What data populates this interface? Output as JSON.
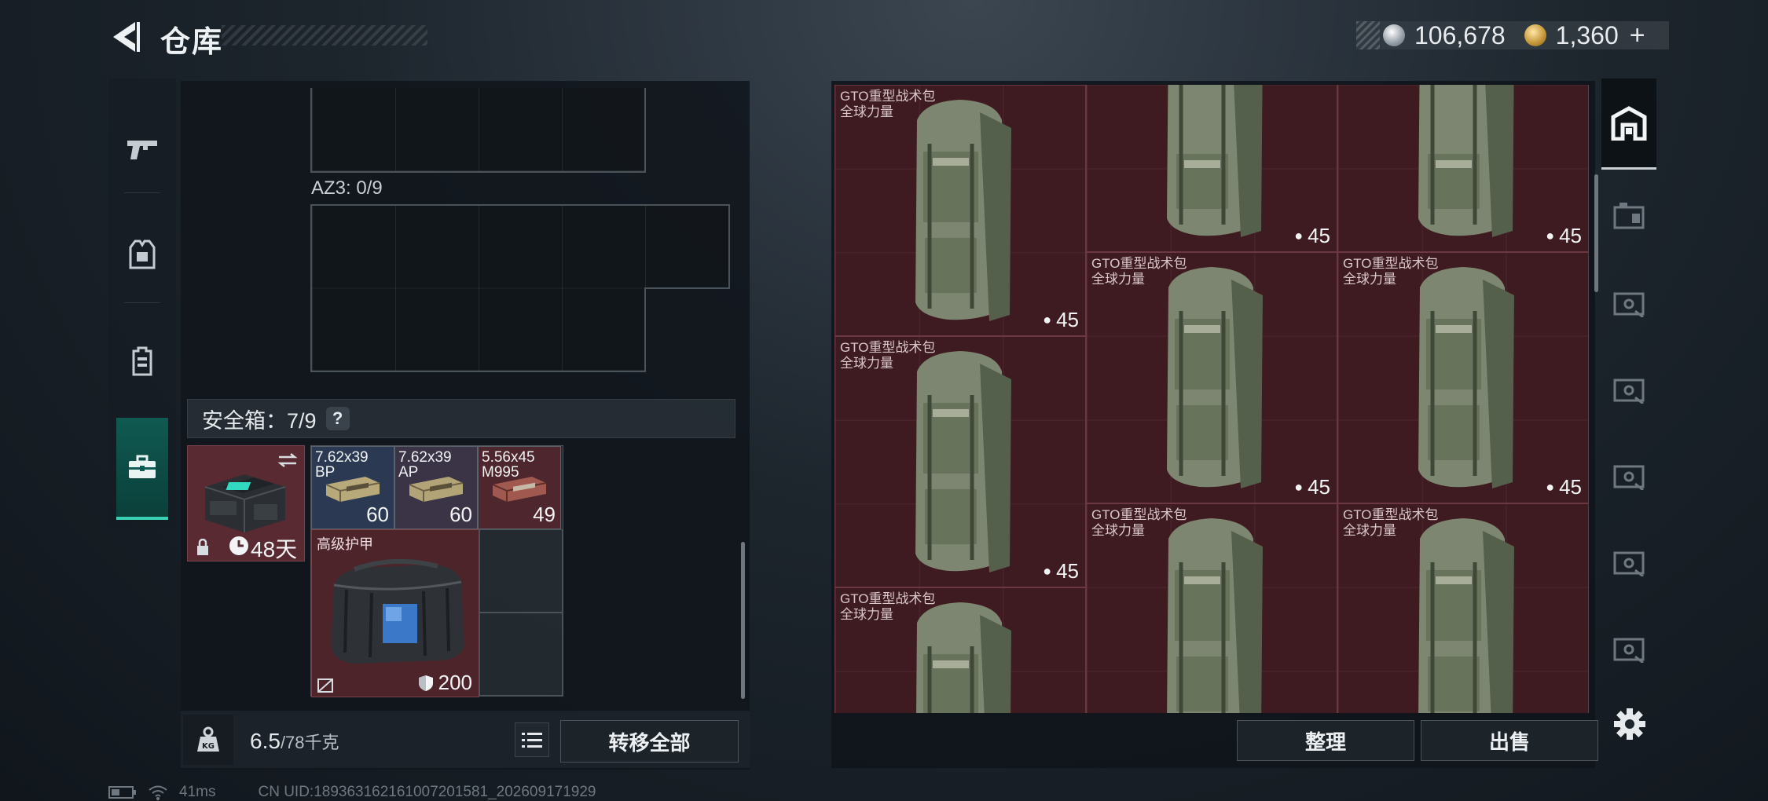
{
  "header": {
    "title": "仓库"
  },
  "currency": {
    "silver": "106,678",
    "gold": "1,360",
    "plus": "+"
  },
  "left_tabs": [
    {
      "icon": "pistol-icon"
    },
    {
      "icon": "vest-icon"
    },
    {
      "icon": "backpack-icon"
    },
    {
      "icon": "briefcase-icon",
      "active": true
    }
  ],
  "left_panel": {
    "az3_label": "AZ3: 0/9",
    "safe_box": {
      "label": "安全箱：7/9",
      "help": "?"
    },
    "container": {
      "days": "48天"
    },
    "ammo": [
      {
        "label": "7.62x39\nBP",
        "count": "60",
        "color": "#2b3a52"
      },
      {
        "label": "7.62x39\nAP",
        "count": "60",
        "color": "#3a3446"
      },
      {
        "label": "5.56x45\nM995",
        "count": "49",
        "color": "#4e262d"
      }
    ],
    "armor": {
      "label": "高级护甲",
      "durability": "200"
    },
    "weight": {
      "current": "6.5",
      "max": "/78千克"
    },
    "transfer_all": "转移全部"
  },
  "stash": {
    "item_name": "GTO重型战术包\n全球力量",
    "capacity": "45",
    "sort_label": "整理",
    "sell_label": "出售"
  },
  "status_bar": {
    "ping": "41ms",
    "uid": "CN UID:189363162161007201581_202609171929"
  }
}
